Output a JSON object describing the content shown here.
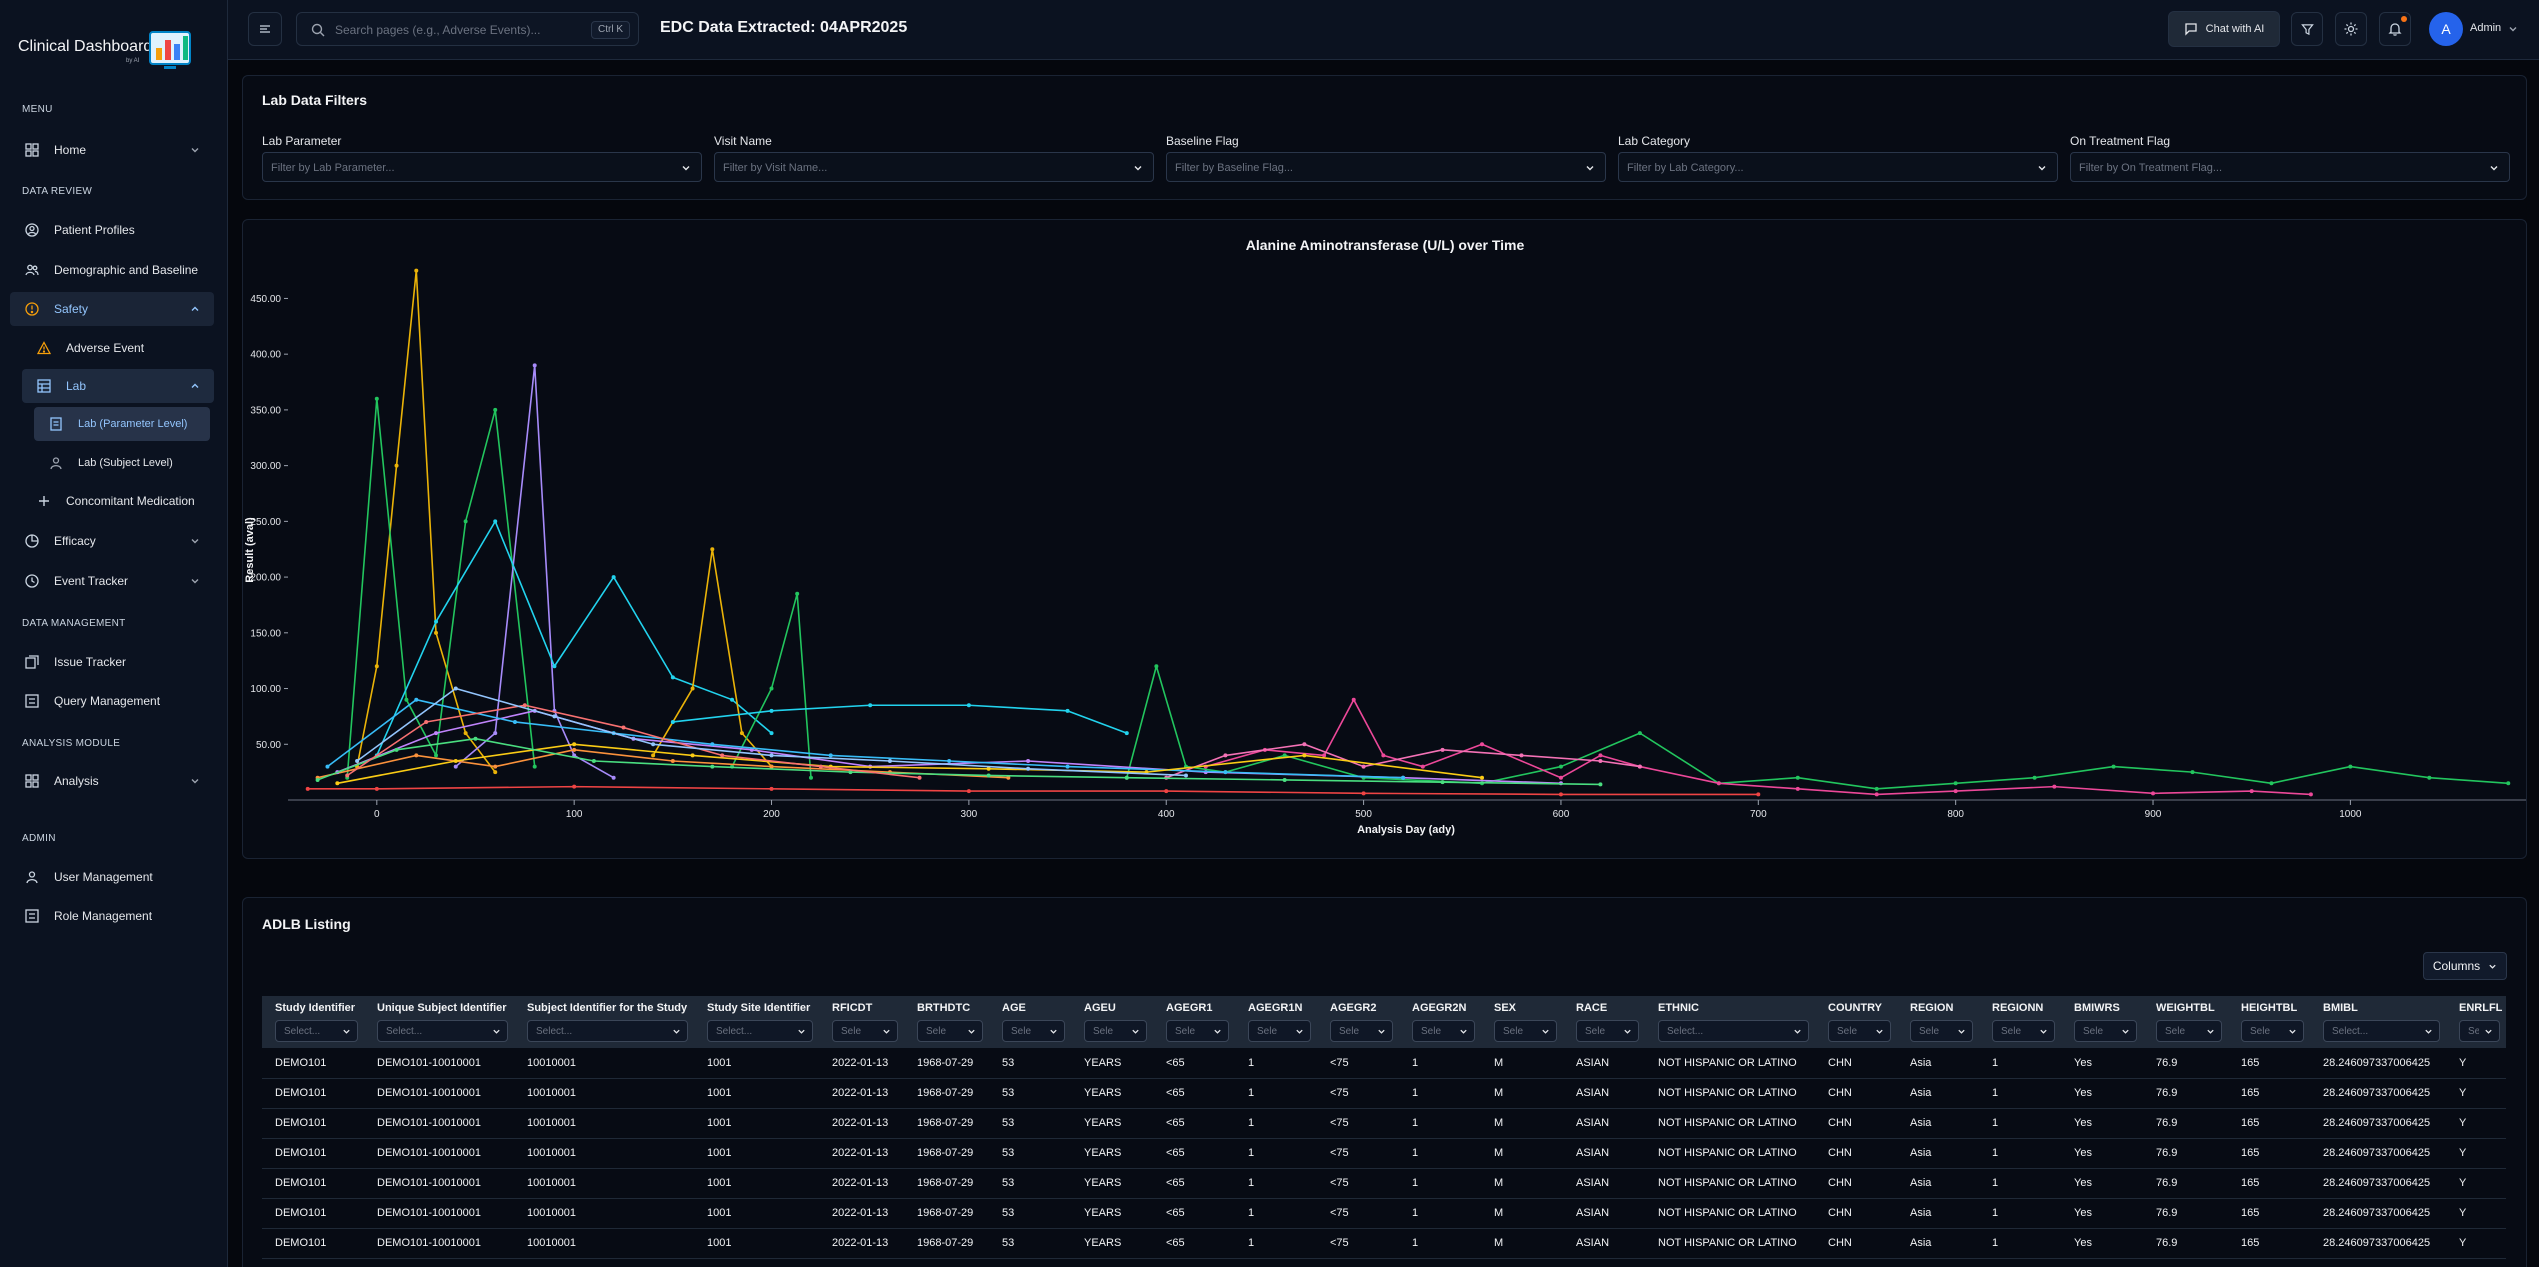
{
  "app": {
    "logo_text": "Clinical Dashboard",
    "logo_sub": "by AI"
  },
  "sidebar": {
    "sections": [
      "MENU",
      "DATA REVIEW",
      "DATA MANAGEMENT",
      "ANALYSIS MODULE",
      "ADMIN"
    ],
    "items": {
      "home": "Home",
      "patient_profiles": "Patient Profiles",
      "demographic": "Demographic and Baseline",
      "safety": "Safety",
      "adverse_event": "Adverse Event",
      "lab": "Lab",
      "lab_param": "Lab (Parameter Level)",
      "lab_subject": "Lab (Subject Level)",
      "conmed": "Concomitant Medication",
      "efficacy": "Efficacy",
      "event_tracker": "Event Tracker",
      "issue_tracker": "Issue Tracker",
      "query_mgmt": "Query Management",
      "analysis": "Analysis",
      "user_mgmt": "User Management",
      "role_mgmt": "Role Management"
    }
  },
  "topbar": {
    "search_placeholder": "Search pages (e.g., Adverse Events)...",
    "search_kbd": "Ctrl K",
    "edc_title": "EDC Data Extracted: 04APR2025",
    "chat_label": "Chat with AI",
    "user_initial": "A",
    "user_name": "Admin",
    "accent": "#2563eb"
  },
  "filters": {
    "title": "Lab Data Filters",
    "items": [
      {
        "label": "Lab Parameter",
        "placeholder": "Filter by Lab Parameter..."
      },
      {
        "label": "Visit Name",
        "placeholder": "Filter by Visit Name..."
      },
      {
        "label": "Baseline Flag",
        "placeholder": "Filter by Baseline Flag..."
      },
      {
        "label": "Lab Category",
        "placeholder": "Filter by Lab Category..."
      },
      {
        "label": "On Treatment Flag",
        "placeholder": "Filter by On Treatment Flag..."
      }
    ]
  },
  "chart_data": {
    "type": "line",
    "title": "Alanine Aminotransferase (U/L) over Time",
    "xlabel": "Analysis Day (ady)",
    "ylabel": "Result (aval)",
    "xlim": [
      -45,
      1090
    ],
    "ylim": [
      0,
      480
    ],
    "xticks": [
      0,
      100,
      200,
      300,
      400,
      500,
      600,
      700,
      800,
      900,
      1000
    ],
    "yticks": [
      50,
      100,
      150,
      200,
      250,
      300,
      350,
      400,
      450
    ],
    "ytick_labels": [
      "50.00",
      "100.00",
      "150.00",
      "200.00",
      "250.00",
      "300.00",
      "350.00",
      "400.00",
      "450.00"
    ],
    "grid": false,
    "legend": "none",
    "series": [
      {
        "color": "#eab308",
        "x": [
          -10,
          0,
          10,
          20,
          30,
          45,
          60
        ],
        "y": [
          30,
          120,
          300,
          475,
          150,
          60,
          25
        ]
      },
      {
        "color": "#22c55e",
        "x": [
          -15,
          0,
          15,
          30,
          45,
          60,
          80
        ],
        "y": [
          20,
          360,
          90,
          40,
          250,
          350,
          30
        ]
      },
      {
        "color": "#a78bfa",
        "x": [
          40,
          60,
          80,
          90,
          100,
          120
        ],
        "y": [
          30,
          60,
          390,
          80,
          40,
          20
        ]
      },
      {
        "color": "#22d3ee",
        "x": [
          0,
          30,
          60,
          90,
          120,
          150,
          180,
          200
        ],
        "y": [
          40,
          160,
          250,
          120,
          200,
          110,
          90,
          60
        ]
      },
      {
        "color": "#eab308",
        "x": [
          140,
          160,
          170,
          185,
          200
        ],
        "y": [
          40,
          100,
          225,
          60,
          30
        ]
      },
      {
        "color": "#22c55e",
        "x": [
          180,
          200,
          213,
          220
        ],
        "y": [
          30,
          100,
          185,
          20
        ]
      },
      {
        "color": "#22d3ee",
        "x": [
          150,
          200,
          250,
          300,
          350,
          380
        ],
        "y": [
          70,
          80,
          85,
          85,
          80,
          60
        ]
      },
      {
        "color": "#22c55e",
        "x": [
          380,
          395,
          410,
          430,
          460,
          500,
          560,
          600,
          640,
          680,
          720,
          760,
          800,
          840,
          880,
          920,
          960,
          1000,
          1040,
          1080
        ],
        "y": [
          20,
          120,
          30,
          25,
          40,
          20,
          15,
          30,
          60,
          15,
          20,
          10,
          15,
          20,
          30,
          25,
          15,
          30,
          20,
          15
        ]
      },
      {
        "color": "#ec4899",
        "x": [
          420,
          450,
          480,
          495,
          510,
          530,
          560,
          600,
          620,
          640,
          680,
          720,
          760,
          800,
          850,
          900,
          950,
          980
        ],
        "y": [
          30,
          45,
          40,
          90,
          40,
          30,
          50,
          20,
          40,
          30,
          15,
          10,
          5,
          8,
          12,
          6,
          8,
          5
        ]
      },
      {
        "color": "#f472b6",
        "x": [
          400,
          430,
          470,
          500,
          540,
          580,
          620,
          640
        ],
        "y": [
          20,
          40,
          50,
          30,
          45,
          40,
          35,
          30
        ]
      },
      {
        "color": "#ef4444",
        "x": [
          -35,
          0,
          100,
          200,
          300,
          400,
          500,
          600,
          700
        ],
        "y": [
          10,
          10,
          12,
          10,
          8,
          8,
          6,
          5,
          5
        ]
      },
      {
        "color": "#fb923c",
        "x": [
          -30,
          20,
          60,
          100,
          150,
          200,
          260,
          320
        ],
        "y": [
          20,
          40,
          30,
          45,
          35,
          30,
          25,
          20
        ]
      },
      {
        "color": "#c084fc",
        "x": [
          -20,
          30,
          80,
          130,
          190,
          250,
          330,
          420,
          520,
          600
        ],
        "y": [
          25,
          60,
          80,
          55,
          45,
          30,
          35,
          25,
          20,
          15
        ]
      },
      {
        "color": "#38bdf8",
        "x": [
          -25,
          20,
          70,
          120,
          170,
          230,
          290,
          350,
          430,
          520
        ],
        "y": [
          30,
          90,
          70,
          60,
          50,
          40,
          35,
          30,
          25,
          20
        ]
      },
      {
        "color": "#facc15",
        "x": [
          -20,
          40,
          100,
          160,
          230,
          310,
          390,
          470,
          560
        ],
        "y": [
          15,
          35,
          50,
          40,
          30,
          28,
          25,
          40,
          20
        ]
      },
      {
        "color": "#4ade80",
        "x": [
          -30,
          10,
          50,
          110,
          170,
          240,
          310,
          380,
          460,
          540,
          620
        ],
        "y": [
          18,
          45,
          55,
          35,
          30,
          25,
          22,
          20,
          18,
          16,
          14
        ]
      },
      {
        "color": "#f87171",
        "x": [
          -15,
          25,
          75,
          125,
          175,
          225,
          275
        ],
        "y": [
          22,
          70,
          85,
          65,
          40,
          30,
          20
        ]
      },
      {
        "color": "#93c5fd",
        "x": [
          -10,
          40,
          90,
          140,
          200,
          260,
          330,
          410
        ],
        "y": [
          35,
          100,
          75,
          50,
          40,
          35,
          28,
          22
        ]
      }
    ]
  },
  "listing": {
    "title": "ADLB Listing",
    "columns_btn": "Columns",
    "headers": [
      "Study Identifier",
      "Unique Subject Identifier",
      "Subject Identifier for the Study",
      "Study Site Identifier",
      "RFICDT",
      "BRTHDTC",
      "AGE",
      "AGEU",
      "AGEGR1",
      "AGEGR1N",
      "AGEGR2",
      "AGEGR2N",
      "SEX",
      "RACE",
      "ETHNIC",
      "COUNTRY",
      "REGION",
      "REGIONN",
      "BMIWRS",
      "WEIGHTBL",
      "HEIGHTBL",
      "BMIBL",
      "ENRLFL"
    ],
    "filter_placeholders": [
      "Select...",
      "Select...",
      "Select...",
      "Select...",
      "Sele",
      "Sele",
      "Sele",
      "Sele",
      "Sele",
      "Sele",
      "Sele",
      "Sele",
      "Sele",
      "Sele",
      "Select...",
      "Sele",
      "Sele",
      "Sele",
      "Sele",
      "Sele",
      "Sele",
      "Select...",
      "Sele"
    ],
    "rows": [
      [
        "DEMO101",
        "DEMO101-10010001",
        "10010001",
        "1001",
        "2022-01-13",
        "1968-07-29",
        "53",
        "YEARS",
        "<65",
        "1",
        "<75",
        "1",
        "M",
        "ASIAN",
        "NOT HISPANIC OR LATINO",
        "CHN",
        "Asia",
        "1",
        "Yes",
        "76.9",
        "165",
        "28.246097337006425",
        "Y"
      ],
      [
        "DEMO101",
        "DEMO101-10010001",
        "10010001",
        "1001",
        "2022-01-13",
        "1968-07-29",
        "53",
        "YEARS",
        "<65",
        "1",
        "<75",
        "1",
        "M",
        "ASIAN",
        "NOT HISPANIC OR LATINO",
        "CHN",
        "Asia",
        "1",
        "Yes",
        "76.9",
        "165",
        "28.246097337006425",
        "Y"
      ],
      [
        "DEMO101",
        "DEMO101-10010001",
        "10010001",
        "1001",
        "2022-01-13",
        "1968-07-29",
        "53",
        "YEARS",
        "<65",
        "1",
        "<75",
        "1",
        "M",
        "ASIAN",
        "NOT HISPANIC OR LATINO",
        "CHN",
        "Asia",
        "1",
        "Yes",
        "76.9",
        "165",
        "28.246097337006425",
        "Y"
      ],
      [
        "DEMO101",
        "DEMO101-10010001",
        "10010001",
        "1001",
        "2022-01-13",
        "1968-07-29",
        "53",
        "YEARS",
        "<65",
        "1",
        "<75",
        "1",
        "M",
        "ASIAN",
        "NOT HISPANIC OR LATINO",
        "CHN",
        "Asia",
        "1",
        "Yes",
        "76.9",
        "165",
        "28.246097337006425",
        "Y"
      ],
      [
        "DEMO101",
        "DEMO101-10010001",
        "10010001",
        "1001",
        "2022-01-13",
        "1968-07-29",
        "53",
        "YEARS",
        "<65",
        "1",
        "<75",
        "1",
        "M",
        "ASIAN",
        "NOT HISPANIC OR LATINO",
        "CHN",
        "Asia",
        "1",
        "Yes",
        "76.9",
        "165",
        "28.246097337006425",
        "Y"
      ],
      [
        "DEMO101",
        "DEMO101-10010001",
        "10010001",
        "1001",
        "2022-01-13",
        "1968-07-29",
        "53",
        "YEARS",
        "<65",
        "1",
        "<75",
        "1",
        "M",
        "ASIAN",
        "NOT HISPANIC OR LATINO",
        "CHN",
        "Asia",
        "1",
        "Yes",
        "76.9",
        "165",
        "28.246097337006425",
        "Y"
      ],
      [
        "DEMO101",
        "DEMO101-10010001",
        "10010001",
        "1001",
        "2022-01-13",
        "1968-07-29",
        "53",
        "YEARS",
        "<65",
        "1",
        "<75",
        "1",
        "M",
        "ASIAN",
        "NOT HISPANIC OR LATINO",
        "CHN",
        "Asia",
        "1",
        "Yes",
        "76.9",
        "165",
        "28.246097337006425",
        "Y"
      ]
    ]
  }
}
